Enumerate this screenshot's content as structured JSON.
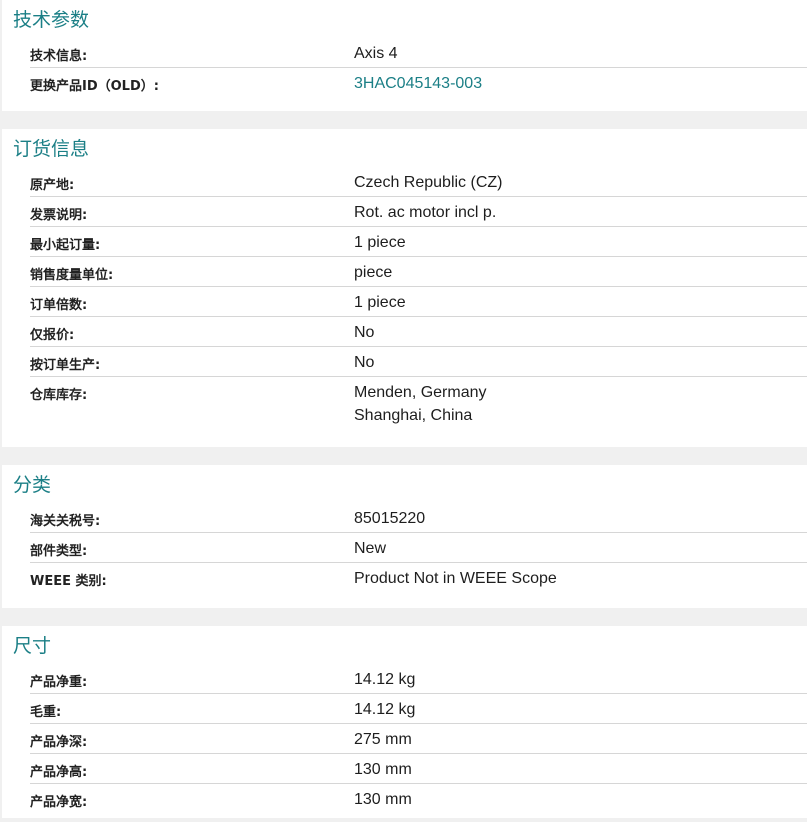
{
  "sections": [
    {
      "title": "技术参数",
      "rows": [
        {
          "label": "技术信息:",
          "value": "Axis 4"
        },
        {
          "label": "更换产品ID（OLD）:",
          "value": "3HAC045143-003"
        }
      ]
    },
    {
      "title": "订货信息",
      "rows": [
        {
          "label": "原产地:",
          "value": "Czech Republic (CZ)"
        },
        {
          "label": "发票说明:",
          "value": "Rot. ac motor incl p."
        },
        {
          "label": "最小起订量:",
          "value": "1 piece"
        },
        {
          "label": "销售度量单位:",
          "value": "piece"
        },
        {
          "label": "订单倍数:",
          "value": "1 piece"
        },
        {
          "label": "仅报价:",
          "value": "No"
        },
        {
          "label": "按订单生产:",
          "value": "No"
        },
        {
          "label": "仓库库存:",
          "values": [
            "Menden, Germany",
            "Shanghai, China"
          ]
        }
      ]
    },
    {
      "title": "分类",
      "rows": [
        {
          "label": "海关关税号:",
          "value": "85015220"
        },
        {
          "label": "部件类型:",
          "value": "New"
        },
        {
          "label": "WEEE 类别:",
          "value": "Product Not in WEEE Scope"
        }
      ]
    },
    {
      "title": "尺寸",
      "rows": [
        {
          "label": "产品净重:",
          "value": "14.12 kg"
        },
        {
          "label": "毛重:",
          "value": "14.12 kg"
        },
        {
          "label": "产品净深:",
          "value": "275 mm"
        },
        {
          "label": "产品净高:",
          "value": "130 mm"
        },
        {
          "label": "产品净宽:",
          "value": "130 mm"
        }
      ]
    }
  ],
  "colors": {
    "accent": "#1b7f86",
    "divider": "#d6d6d6",
    "page_bg": "#f0f0f0"
  }
}
